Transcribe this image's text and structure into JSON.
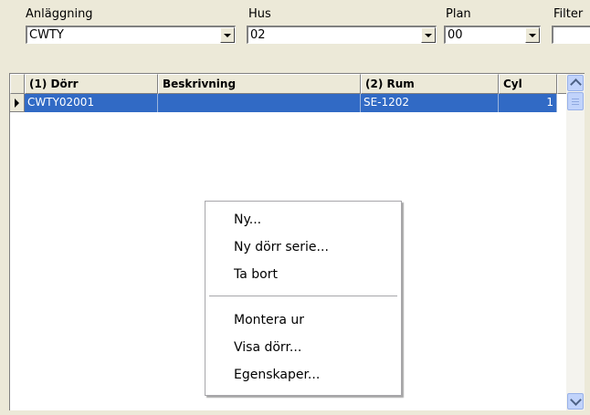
{
  "filters": {
    "anlaggning": {
      "label": "Anläggning",
      "value": "CWTY"
    },
    "hus": {
      "label": "Hus",
      "value": "02"
    },
    "plan": {
      "label": "Plan",
      "value": "00"
    },
    "filter": {
      "label": "Filter",
      "value": ""
    }
  },
  "grid": {
    "columns": [
      "(1) Dörr",
      "Beskrivning",
      "(2) Rum",
      "Cyl"
    ],
    "rows": [
      {
        "dorr": "CWTY02001",
        "beskrivning": "",
        "rum": "SE-1202",
        "cyl": "1"
      }
    ],
    "colors": {
      "selection": "#316ac5"
    }
  },
  "context_menu": {
    "items": [
      "Ny...",
      "Ny dörr serie...",
      "Ta bort",
      "Montera ur",
      "Visa dörr...",
      "Egenskaper..."
    ]
  },
  "icons": {
    "dropdown": "chevron-down-icon",
    "row_indicator": "row-pointer-icon",
    "scroll_up": "chevron-up-icon",
    "scroll_down": "chevron-down-icon"
  }
}
